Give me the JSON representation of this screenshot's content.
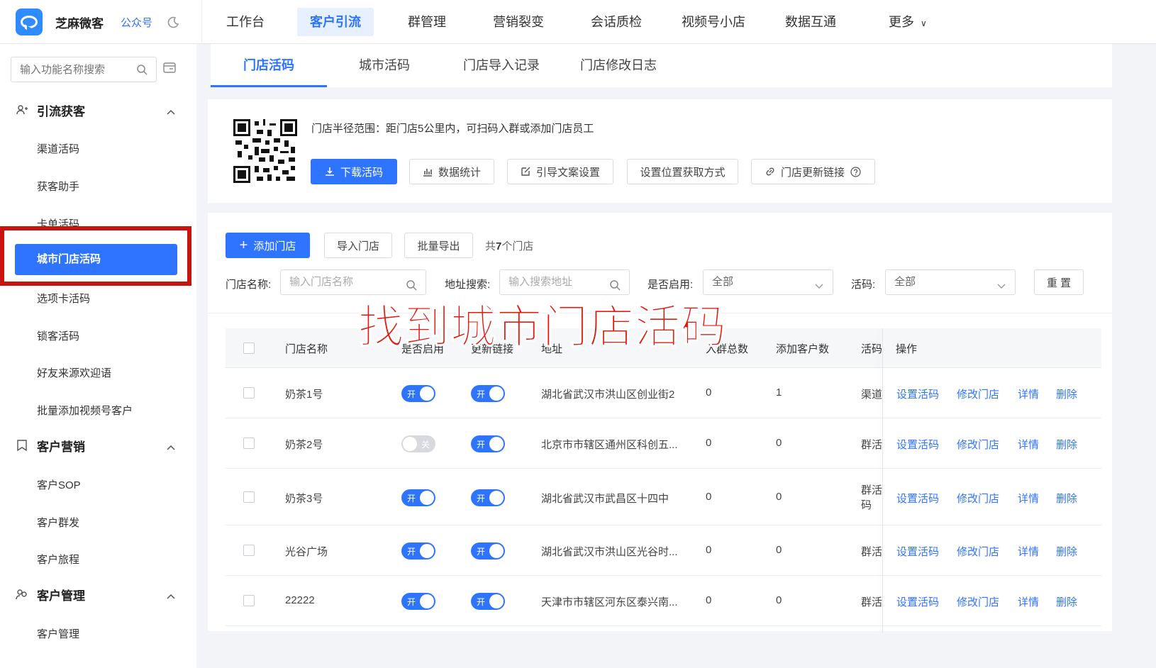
{
  "brand": {
    "name": "芝麻微客",
    "link": "公众号"
  },
  "nav": [
    "工作台",
    "客户引流",
    "群管理",
    "营销裂变",
    "会话质检",
    "视频号小店",
    "数据互通",
    "更多"
  ],
  "nav_active": "客户引流",
  "sidebar": {
    "search_placeholder": "输入功能名称搜索",
    "groups": [
      {
        "title": "引流获客",
        "items": [
          "渠道活码",
          "获客助手",
          "卡单活码",
          "城市门店活码",
          "选项卡活码",
          "锁客活码",
          "好友来源欢迎语",
          "批量添加视频号客户"
        ]
      },
      {
        "title": "客户营销",
        "items": [
          "客户SOP",
          "客户群发",
          "客户旅程"
        ]
      },
      {
        "title": "客户管理",
        "items": [
          "客户管理"
        ]
      }
    ],
    "active_item": "城市门店活码"
  },
  "tabs": [
    "门店活码",
    "城市活码",
    "门店导入记录",
    "门店修改日志"
  ],
  "info": {
    "radius_text": "门店半径范围：距门店5公里内，可扫码入群或添加门店员工",
    "buttons": [
      "下载活码",
      "数据统计",
      "引导文案设置",
      "设置位置获取方式",
      "门店更新链接"
    ]
  },
  "actions": {
    "add": "添加门店",
    "import": "导入门店",
    "export": "批量导出",
    "count_prefix": "共",
    "count": "7",
    "count_suffix": "个门店"
  },
  "filters": {
    "name_label": "门店名称:",
    "name_placeholder": "输入门店名称",
    "addr_label": "地址搜索:",
    "addr_placeholder": "输入搜索地址",
    "enabled_label": "是否启用:",
    "enabled_value": "全部",
    "code_label": "活码:",
    "code_value": "全部",
    "reset": "重 置"
  },
  "table": {
    "headers": [
      "门店名称",
      "是否启用",
      "更新链接",
      "地址",
      "入群总数",
      "添加客户数",
      "活码",
      "操作"
    ],
    "rows": [
      {
        "name": "奶茶1号",
        "enabled": true,
        "update": true,
        "address": "湖北省武汉市洪山区创业街2",
        "groups": "0",
        "customers": "1",
        "code": "渠道"
      },
      {
        "name": "奶茶2号",
        "enabled": false,
        "update": true,
        "address": "北京市市辖区通州区科创五...",
        "groups": "0",
        "customers": "0",
        "code": "群活"
      },
      {
        "name": "奶茶3号",
        "enabled": true,
        "update": true,
        "address": "湖北省武汉市武昌区十四中",
        "groups": "0",
        "customers": "0",
        "code": "群活码"
      },
      {
        "name": "光谷广场",
        "enabled": true,
        "update": true,
        "address": "湖北省武汉市洪山区光谷时...",
        "groups": "0",
        "customers": "0",
        "code": "群活"
      },
      {
        "name": "22222",
        "enabled": true,
        "update": true,
        "address": "天津市市辖区河东区泰兴南...",
        "groups": "0",
        "customers": "0",
        "code": "群活"
      }
    ],
    "ops": [
      "设置活码",
      "修改门店",
      "详情",
      "删除"
    ],
    "on": "开",
    "off": "关"
  },
  "overlay_text": "找到城市门店活码"
}
